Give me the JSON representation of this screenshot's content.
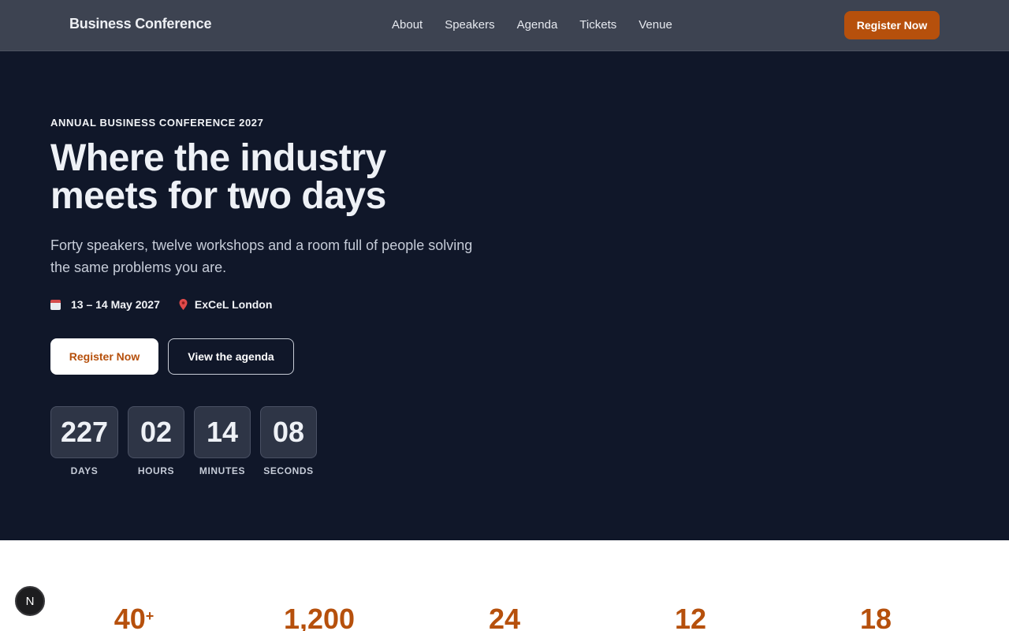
{
  "header": {
    "brand": "Business Conference",
    "nav": [
      "About",
      "Speakers",
      "Agenda",
      "Tickets",
      "Venue"
    ],
    "cta": "Register Now"
  },
  "hero": {
    "eyebrow": "ANNUAL BUSINESS CONFERENCE 2027",
    "headline_line1": "Where the industry",
    "headline_line2": "meets for two days",
    "subtitle": "Forty speakers, twelve workshops and a room full of people solving the same problems you are.",
    "date": "13 – 14 May 2027",
    "venue": "ExCeL London",
    "primary_cta": "Register Now",
    "secondary_cta": "View the agenda",
    "countdown": [
      {
        "value": "227",
        "label": "DAYS"
      },
      {
        "value": "02",
        "label": "HOURS"
      },
      {
        "value": "14",
        "label": "MINUTES"
      },
      {
        "value": "08",
        "label": "SECONDS"
      }
    ]
  },
  "stats": [
    {
      "value": "40",
      "suffix": "+"
    },
    {
      "value": "1,200",
      "suffix": ""
    },
    {
      "value": "24",
      "suffix": ""
    },
    {
      "value": "12",
      "suffix": ""
    },
    {
      "value": "18",
      "suffix": ""
    }
  ],
  "dev_badge": "N",
  "colors": {
    "accent": "#b6500c",
    "hero_bg": "#101729",
    "header_bg": "#3d4351"
  }
}
